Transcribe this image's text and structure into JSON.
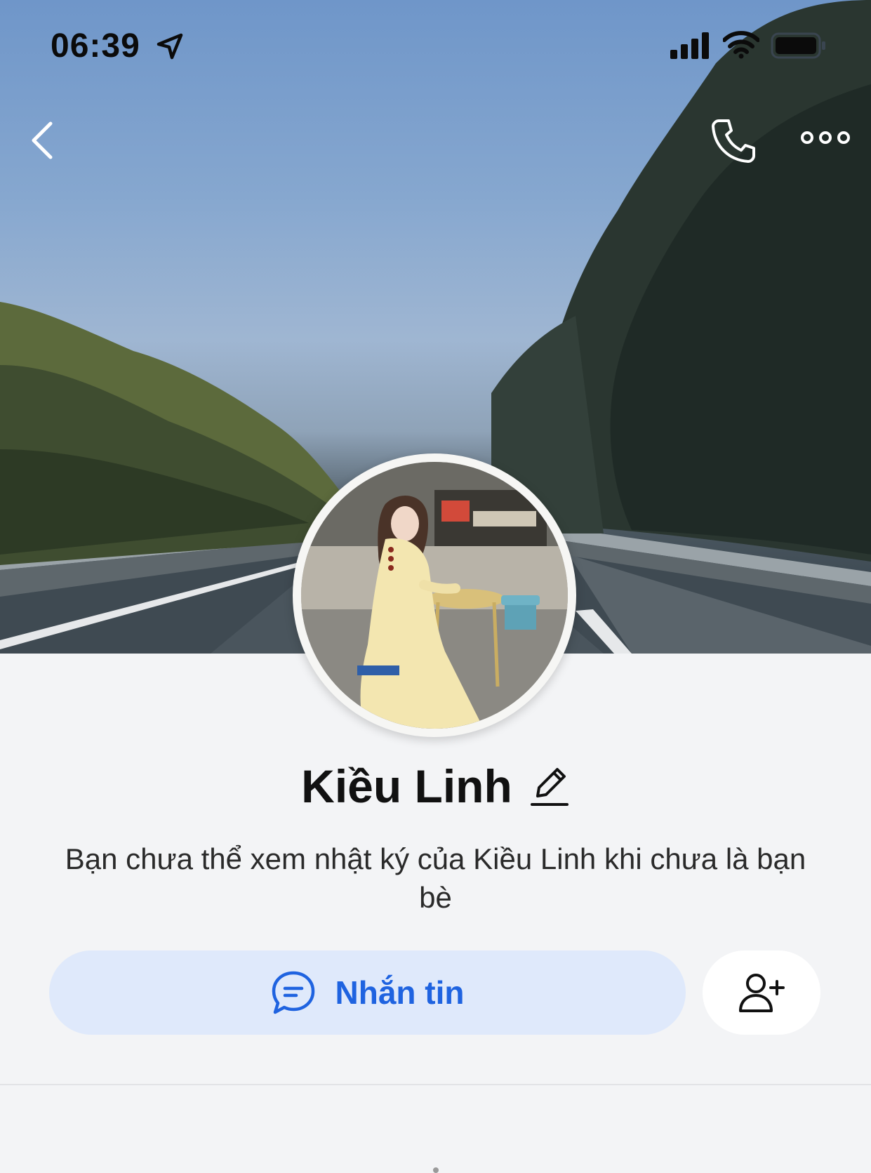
{
  "status_bar": {
    "time": "06:39",
    "location_icon": "location-arrow-icon",
    "signal_icon": "cellular-signal-icon",
    "wifi_icon": "wifi-icon",
    "battery_icon": "battery-icon"
  },
  "nav": {
    "back_icon": "chevron-left-icon",
    "call_icon": "phone-icon",
    "more_icon": "more-horizontal-icon"
  },
  "profile": {
    "name": "Kiều Linh",
    "edit_icon": "pencil-icon",
    "notice": "Bạn chưa thể xem nhật ký của Kiều Linh khi chưa là bạn bè"
  },
  "actions": {
    "message_label": "Nhắn tin",
    "message_icon": "chat-bubble-icon",
    "add_friend_icon": "add-friend-icon"
  },
  "colors": {
    "accent": "#1f63e0",
    "message_button_bg": "#dfe9fb",
    "page_bg": "#f3f4f6"
  }
}
